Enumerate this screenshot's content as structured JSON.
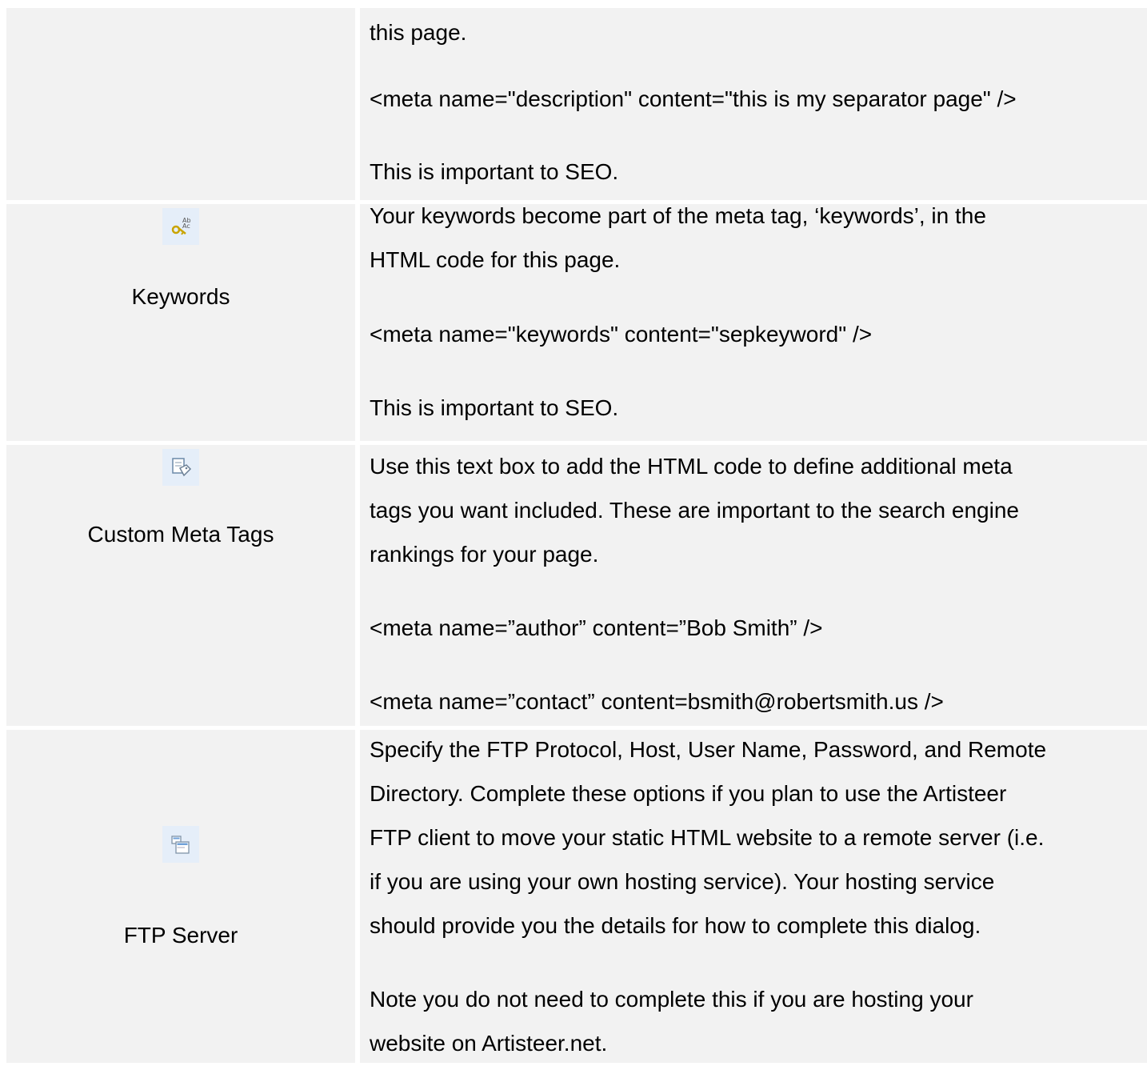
{
  "rows": [
    {
      "label": "",
      "icon": "",
      "paragraphs": [
        "this page.",
        "<meta name=\"description\" content=\"this is my separator page\" />",
        "This is important to SEO."
      ]
    },
    {
      "label": "Keywords",
      "icon": "keywords-key-icon",
      "paragraphs": [
        "Your keywords become part of the meta tag, ‘keywords’, in the",
        "HTML code for this page.",
        "<meta name=\"keywords\" content=\"sepkeyword\" />",
        "This is important to SEO."
      ]
    },
    {
      "label": "Custom Meta Tags",
      "icon": "custom-meta-tags-icon",
      "paragraphs": [
        "Use this text box to add the HTML code to define additional meta",
        "tags you want included.  These are important to the search engine",
        "rankings for your page.",
        "<meta name=”author” content=”Bob Smith” />",
        "<meta name=”contact” content=bsmith@robertsmith.us />"
      ]
    },
    {
      "label": "FTP Server",
      "icon": "ftp-server-icon",
      "paragraphs": [
        "Specify the FTP Protocol, Host, User Name, Password, and Remote",
        "Directory.  Complete these options if you plan to use the Artisteer",
        "FTP client to move your static HTML website to a remote server (i.e.",
        "if you are using your own hosting service).   Your hosting service",
        "should provide you the details for how to complete this dialog.",
        "Note you do not need to complete this if you are hosting your",
        "website on Artisteer.net."
      ]
    }
  ]
}
